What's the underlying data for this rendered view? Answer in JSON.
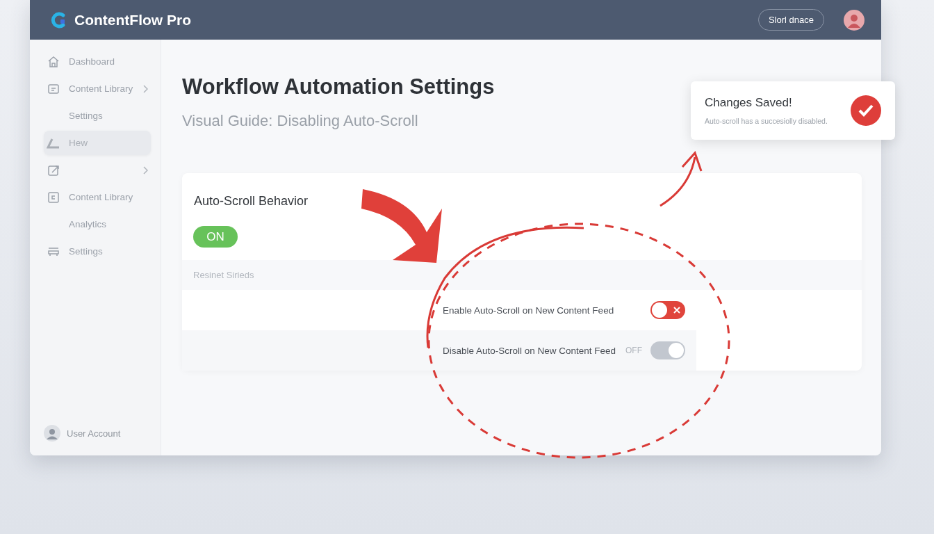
{
  "app": {
    "title": "ContentFlow Pro",
    "header_button": "Slorl dnace"
  },
  "sidebar": {
    "items": [
      {
        "kind": "home",
        "label": "Dashboard",
        "chevron": false,
        "selected": false
      },
      {
        "kind": "library",
        "label": "Content Library",
        "chevron": true,
        "selected": false
      },
      {
        "kind": "text",
        "label": "Settings",
        "chevron": false,
        "selected": false
      },
      {
        "kind": "undo",
        "label": "Hew",
        "chevron": false,
        "selected": true
      },
      {
        "kind": "edit",
        "chevron": true,
        "selected": false
      },
      {
        "kind": "box",
        "label": "Content Library",
        "chevron": false,
        "selected": false
      },
      {
        "kind": "text",
        "label": "Analytics",
        "chevron": false,
        "selected": false
      },
      {
        "kind": "tray",
        "label": "Settings",
        "chevron": false,
        "selected": false
      }
    ],
    "account": "User Account"
  },
  "page": {
    "title": "Workflow Automation Settings",
    "subtitle": "Visual Guide: Disabling Auto-Scroll"
  },
  "card": {
    "title": "Auto-Scroll Behavior",
    "master": {
      "label": "ON",
      "on": true
    },
    "section": "Resinet Sirieds",
    "rows": [
      {
        "label": "Enable Auto-Scroll on New Content Feed",
        "kind": "danger"
      },
      {
        "label": "Disable Auto-Scroll on New Content Feed",
        "kind": "neutral",
        "state_text": "OFF"
      }
    ]
  },
  "toast": {
    "title": "Changes Saved!",
    "message": "Auto-scroll has a succesiolly disabled."
  }
}
